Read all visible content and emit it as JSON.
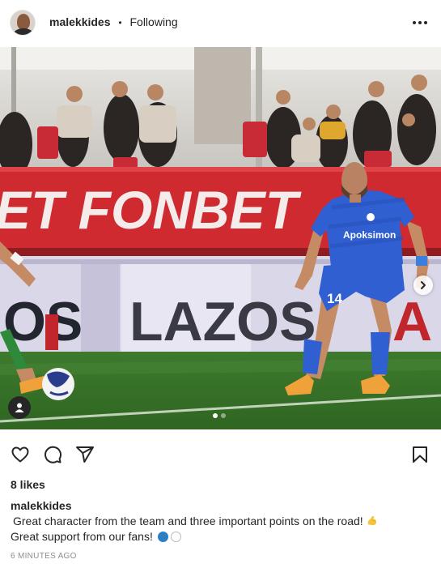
{
  "post": {
    "username": "malekkides",
    "separator": "•",
    "follow_status": "Following",
    "more_icon": "more-options-icon"
  },
  "photo": {
    "banner_text": "ET FONBET",
    "board_text_left": "OS",
    "board_text_right": "LAZOS",
    "board_text_far": "A",
    "jersey_sponsor": "Apoksimon",
    "jersey_number": "14",
    "carousel_count": 2,
    "carousel_active_index": 0,
    "colors": {
      "jersey": "#2f5fd0",
      "pitch": "#3f7a2c",
      "banner": "#d6262c",
      "boots": "#f0a23a"
    }
  },
  "actions": {
    "like": "heart-icon",
    "comment": "comment-icon",
    "share": "share-icon",
    "save": "bookmark-icon"
  },
  "likes_text": "8 likes",
  "caption": {
    "username": "malekkides",
    "line1": "Great character from the team and three important points on the road!",
    "line2": "Great support from our fans!"
  },
  "timestamp": "6 minutes ago"
}
